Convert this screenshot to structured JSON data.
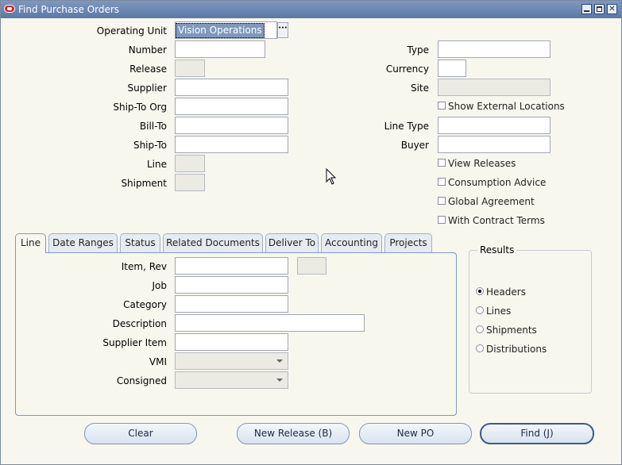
{
  "window": {
    "title": "Find Purchase Orders"
  },
  "header_fields": {
    "operating_unit": {
      "label": "Operating Unit",
      "value": "Vision Operations"
    },
    "number": {
      "label": "Number"
    },
    "release": {
      "label": "Release"
    },
    "supplier": {
      "label": "Supplier"
    },
    "ship_to_org": {
      "label": "Ship-To Org"
    },
    "bill_to": {
      "label": "Bill-To"
    },
    "ship_to": {
      "label": "Ship-To"
    },
    "line": {
      "label": "Line"
    },
    "shipment": {
      "label": "Shipment"
    },
    "type": {
      "label": "Type"
    },
    "currency": {
      "label": "Currency"
    },
    "site": {
      "label": "Site"
    },
    "line_type": {
      "label": "Line Type"
    },
    "buyer": {
      "label": "Buyer"
    }
  },
  "checkboxes": {
    "show_external_locations": {
      "label": "Show External Locations",
      "checked": false
    },
    "view_releases": {
      "label": "View Releases",
      "checked": false
    },
    "consumption_advice": {
      "label": "Consumption Advice",
      "checked": false
    },
    "global_agreement": {
      "label": "Global Agreement",
      "checked": false
    },
    "with_contract_terms": {
      "label": "With Contract Terms",
      "checked": false
    }
  },
  "tabs": [
    {
      "label": "Line",
      "active": true
    },
    {
      "label": "Date Ranges"
    },
    {
      "label": "Status"
    },
    {
      "label": "Related Documents"
    },
    {
      "label": "Deliver To"
    },
    {
      "label": "Accounting"
    },
    {
      "label": "Projects"
    }
  ],
  "line_tab": {
    "item_rev": {
      "label": "Item, Rev"
    },
    "job": {
      "label": "Job"
    },
    "category": {
      "label": "Category"
    },
    "description": {
      "label": "Description"
    },
    "supplier_item": {
      "label": "Supplier Item"
    },
    "vmi": {
      "label": "VMI",
      "value": ""
    },
    "consigned": {
      "label": "Consigned",
      "value": ""
    }
  },
  "results": {
    "title": "Results",
    "options": [
      {
        "label": "Headers",
        "selected": true
      },
      {
        "label": "Lines"
      },
      {
        "label": "Shipments"
      },
      {
        "label": "Distributions"
      }
    ]
  },
  "buttons": {
    "clear": "Clear",
    "new_release": "New Release (B)",
    "new_po": "New PO",
    "find": "Find (J)"
  },
  "icons": {
    "window_logo": "oracle-logo-icon",
    "minimize": "minimize-icon",
    "maximize": "maximize-icon",
    "close": "close-icon",
    "lov": "ellipsis-icon",
    "dropdown": "chevron-down-icon",
    "pointer": "mouse-pointer-icon"
  },
  "colors": {
    "titlebar": "#5b78a6",
    "background": "#f7f7ee",
    "selection": "#7f98bd"
  }
}
